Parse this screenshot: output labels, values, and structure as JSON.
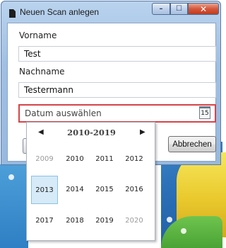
{
  "window": {
    "title": "Neuen Scan anlegen",
    "controls": {
      "minimize": "–",
      "maximize": "☐",
      "close": "✕"
    }
  },
  "form": {
    "vorname_label": "Vorname",
    "vorname_value": "Test",
    "nachname_label": "Nachname",
    "nachname_value": "Testermann",
    "date_placeholder": "Datum auswählen",
    "calendar_icon_day": "15",
    "cancel_label": "Abbrechen"
  },
  "calendar": {
    "header": "2010-2019",
    "prev": "◀",
    "next": "▶",
    "years": [
      "2009",
      "2010",
      "2011",
      "2012",
      "2013",
      "2014",
      "2015",
      "2016",
      "2017",
      "2018",
      "2019",
      "2020"
    ],
    "selected": "2013"
  },
  "colors": {
    "accent_error": "#d5444a",
    "selected_bg": "#d6eaf8"
  }
}
